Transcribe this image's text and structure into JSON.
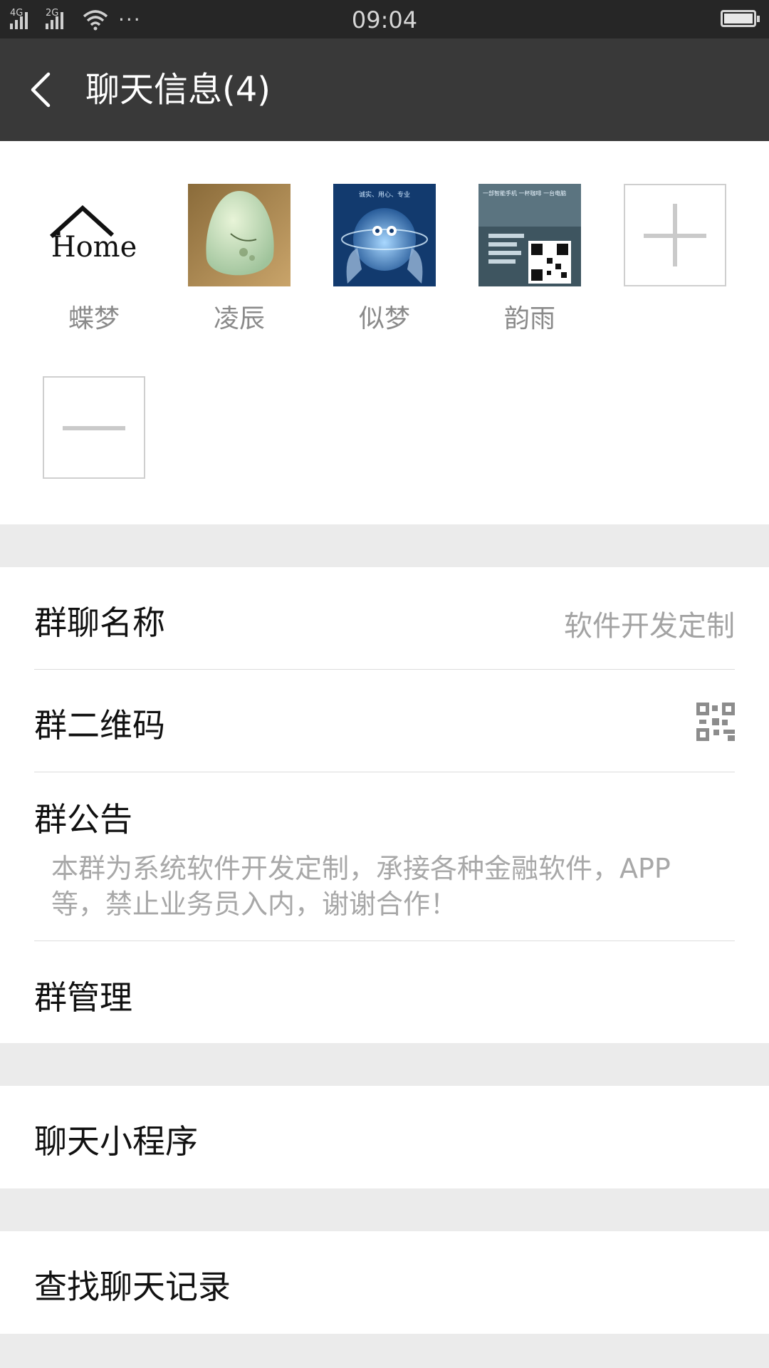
{
  "status_bar": {
    "network_1": "4G",
    "network_2": "2G",
    "more": "···",
    "time": "09:04"
  },
  "header": {
    "back_icon": "chevron-left-icon",
    "title": "聊天信息(4)"
  },
  "members": [
    {
      "name": "蝶梦",
      "avatar_caption": "Home"
    },
    {
      "name": "凌辰"
    },
    {
      "name": "似梦",
      "avatar_caption": "诚实、用心、专业"
    },
    {
      "name": "韵雨",
      "avatar_caption": "一部智能手机 一杯咖啡 一台电脑"
    }
  ],
  "member_actions": {
    "add_icon": "plus-icon",
    "remove_icon": "minus-icon"
  },
  "settings": {
    "group_name_label": "群聊名称",
    "group_name_value": "软件开发定制",
    "group_qr_label": "群二维码",
    "group_qr_icon": "qr-code-icon",
    "announcement_label": "群公告",
    "announcement_text": "本群为系统软件开发定制，承接各种金融软件，APP等，禁止业务员入内，谢谢合作！",
    "manage_label": "群管理"
  },
  "mini_programs": {
    "label": "聊天小程序"
  },
  "search": {
    "label": "查找聊天记录"
  },
  "colors": {
    "status_bar_bg": "#262626",
    "title_bar_bg": "#393939",
    "page_bg": "#ebebeb",
    "secondary_text": "#a3a3a3"
  }
}
